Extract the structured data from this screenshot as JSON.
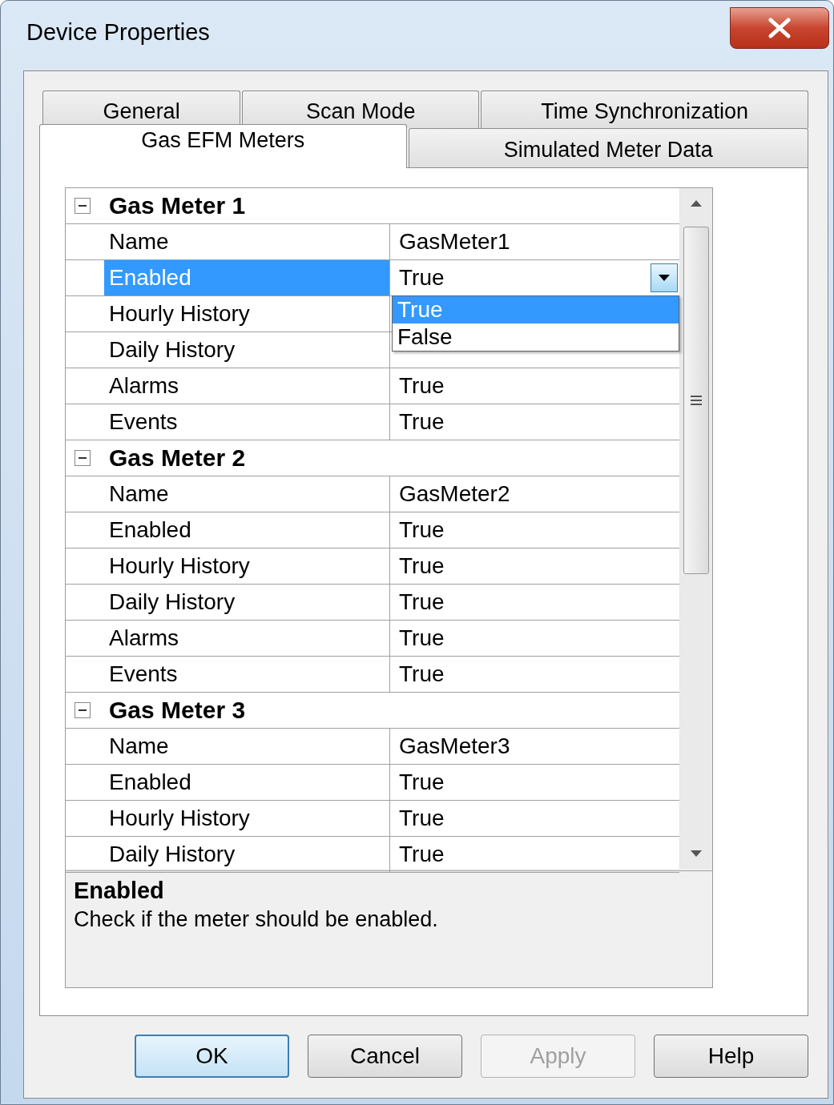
{
  "window": {
    "title": "Device Properties"
  },
  "tab_rows": [
    [
      {
        "label": "General",
        "selected": false
      },
      {
        "label": "Scan Mode",
        "selected": false
      },
      {
        "label": "Time Synchronization",
        "selected": false
      }
    ],
    [
      {
        "label": "Gas EFM Meters",
        "selected": true
      },
      {
        "label": "Simulated Meter Data",
        "selected": false
      }
    ]
  ],
  "groups": [
    {
      "title": "Gas Meter 1",
      "expanded": true,
      "properties": [
        {
          "name": "Name",
          "value": "GasMeter1",
          "selected": false
        },
        {
          "name": "Enabled",
          "value": "True",
          "selected": true,
          "dropdown": {
            "options": [
              {
                "label": "True",
                "selected": true
              },
              {
                "label": "False",
                "selected": false
              }
            ]
          }
        },
        {
          "name": "Hourly History",
          "selected": false
        },
        {
          "name": "Daily History",
          "selected": false
        },
        {
          "name": "Alarms",
          "value": "True",
          "selected": false
        },
        {
          "name": "Events",
          "value": "True",
          "selected": false
        }
      ]
    },
    {
      "title": "Gas Meter 2",
      "expanded": true,
      "properties": [
        {
          "name": "Name",
          "value": "GasMeter2",
          "selected": false
        },
        {
          "name": "Enabled",
          "value": "True",
          "selected": false
        },
        {
          "name": "Hourly History",
          "value": "True",
          "selected": false
        },
        {
          "name": "Daily History",
          "value": "True",
          "selected": false
        },
        {
          "name": "Alarms",
          "value": "True",
          "selected": false
        },
        {
          "name": "Events",
          "value": "True",
          "selected": false
        }
      ]
    },
    {
      "title": "Gas Meter 3",
      "expanded": true,
      "properties": [
        {
          "name": "Name",
          "value": "GasMeter3",
          "selected": false
        },
        {
          "name": "Enabled",
          "value": "True",
          "selected": false
        },
        {
          "name": "Hourly History",
          "value": "True",
          "selected": false
        },
        {
          "name": "Daily History",
          "value": "True",
          "selected": false
        }
      ]
    }
  ],
  "description": {
    "title": "Enabled",
    "text": "Check if the meter should be enabled."
  },
  "buttons": [
    {
      "label": "OK",
      "default": true,
      "disabled": false
    },
    {
      "label": "Cancel",
      "default": false,
      "disabled": false
    },
    {
      "label": "Apply",
      "default": false,
      "disabled": true
    },
    {
      "label": "Help",
      "default": false,
      "disabled": false
    }
  ]
}
